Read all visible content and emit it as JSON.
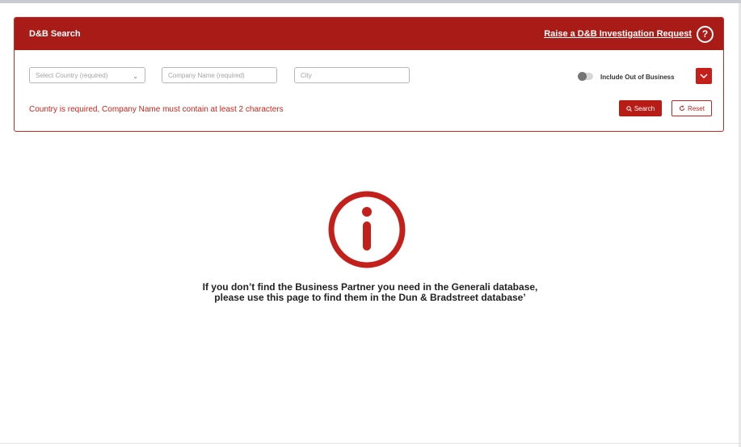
{
  "header": {
    "title": "D&B Search",
    "investigation_link": "Raise a D&B Investigation Request",
    "help_glyph": "?"
  },
  "form": {
    "country_placeholder": "Select Country (required)",
    "company_placeholder": "Company Name (required)",
    "city_placeholder": "City",
    "include_out_of_business_label": "Include Out of Business",
    "include_out_of_business": false,
    "error_message": "Country is required, Company Name must contain at least 2 characters",
    "search_label": "Search",
    "reset_label": "Reset"
  },
  "info": {
    "line1": "If you don’t find the Business Partner you need in the Generali database,",
    "line2": "please use this page to find them in the Dun & Bradstreet database’"
  },
  "icons": [
    "help-icon",
    "chevron-down-icon",
    "search-icon",
    "reset-icon",
    "info-icon"
  ],
  "colors": {
    "brand_red": "#a81b17",
    "accent_red": "#c41f1a",
    "info_red": "#c3201b"
  }
}
